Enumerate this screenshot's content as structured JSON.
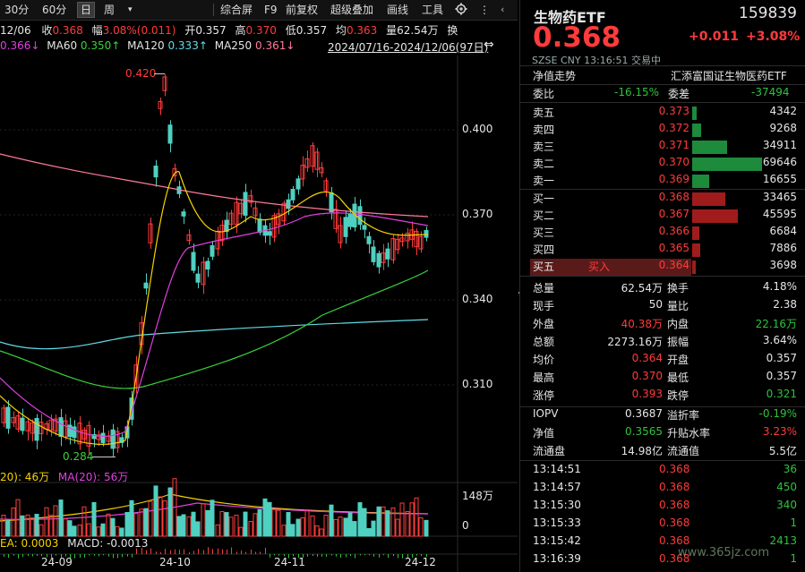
{
  "toolbar": {
    "periods": [
      "30分",
      "60分",
      "日",
      "周"
    ],
    "active_period": "日",
    "more_icon": "dropdown-triangle",
    "menus": [
      "综合屏",
      "F9",
      "前复权",
      "超级叠加",
      "画线",
      "工具"
    ],
    "settings_icon": "gear-icon",
    "more_menu": "⋮"
  },
  "info_bar": {
    "date": "12/06",
    "close_label": "收",
    "close": "0.368",
    "range_label": "幅",
    "range": "3.08%(0.011)",
    "open_label": "开",
    "open": "0.357",
    "high_label": "高",
    "high": "0.370",
    "low_label": "低",
    "low": "0.357",
    "avg_label": "均",
    "avg": "0.363",
    "vol_label": "量",
    "vol": "62.54万",
    "switch_label": "换"
  },
  "ma_bar": {
    "ma_prev": "0.366↓",
    "ma60": "MA60",
    "ma60_val": "0.350↑",
    "ma120": "MA120",
    "ma120_val": "0.333↑",
    "ma250": "MA250",
    "ma250_val": "0.361↓",
    "date_range": "2024/07/16-2024/12/06(97日)",
    "switch_icon": "⇔"
  },
  "price_axis": [
    "0.400",
    "0.370",
    "0.340",
    "0.310"
  ],
  "annotations": {
    "high_mark": "0.420",
    "low_mark": "0.284"
  },
  "volume": {
    "label_a": "20): 46万",
    "label_b": "MA(20): 56万",
    "axis_top": "148万",
    "axis_zero": "0"
  },
  "macd": {
    "dea": "EA: 0.0003",
    "macd": "MACD: -0.0013"
  },
  "date_axis": [
    "24-09",
    "24-10",
    "24-11",
    "24-12"
  ],
  "quote": {
    "name": "生物药ETF",
    "code": "159839",
    "price": "0.368",
    "change": "+0.011",
    "change_pct": "+3.08%",
    "exchange": "SZSE",
    "currency": "CNY",
    "time": "13:16:51",
    "status": "交易中",
    "nav_trend": "净值走势",
    "fund_name": "汇添富国证生物医药ETF",
    "webi_label": "委比",
    "webi": "-16.15%",
    "weicha_label": "委差",
    "weicha": "-37494"
  },
  "order_book": {
    "asks": [
      {
        "label": "卖五",
        "price": "0.373",
        "vol": "4342",
        "ratio": 0.06
      },
      {
        "label": "卖四",
        "price": "0.372",
        "vol": "9268",
        "ratio": 0.13
      },
      {
        "label": "卖三",
        "price": "0.371",
        "vol": "34911",
        "ratio": 0.5
      },
      {
        "label": "卖二",
        "price": "0.370",
        "vol": "69646",
        "ratio": 1.0
      },
      {
        "label": "卖一",
        "price": "0.369",
        "vol": "16655",
        "ratio": 0.24
      }
    ],
    "bids": [
      {
        "label": "买一",
        "price": "0.368",
        "vol": "33465",
        "ratio": 0.48
      },
      {
        "label": "买二",
        "price": "0.367",
        "vol": "45595",
        "ratio": 0.65
      },
      {
        "label": "买三",
        "price": "0.366",
        "vol": "6684",
        "ratio": 0.1
      },
      {
        "label": "买四",
        "price": "0.365",
        "vol": "7886",
        "ratio": 0.11
      },
      {
        "label": "买五",
        "price": "0.364",
        "vol": "3698",
        "ratio": 0.05
      }
    ],
    "buy_button": "买入"
  },
  "stats": [
    {
      "l1": "总量",
      "v1": "62.54万",
      "c1": "white",
      "l2": "换手",
      "v2": "4.18%",
      "c2": "white"
    },
    {
      "l1": "现手",
      "v1": "50",
      "c1": "white",
      "l2": "量比",
      "v2": "2.38",
      "c2": "white"
    },
    {
      "l1": "外盘",
      "v1": "40.38万",
      "c1": "red",
      "l2": "内盘",
      "v2": "22.16万",
      "c2": "green"
    },
    {
      "l1": "总额",
      "v1": "2273.16万",
      "c1": "white",
      "l2": "振幅",
      "v2": "3.64%",
      "c2": "white"
    },
    {
      "l1": "均价",
      "v1": "0.364",
      "c1": "red",
      "l2": "开盘",
      "v2": "0.357",
      "c2": "white"
    },
    {
      "l1": "最高",
      "v1": "0.370",
      "c1": "red",
      "l2": "最低",
      "v2": "0.357",
      "c2": "white"
    },
    {
      "l1": "涨停",
      "v1": "0.393",
      "c1": "red",
      "l2": "跌停",
      "v2": "0.321",
      "c2": "green"
    }
  ],
  "fund_stats": [
    {
      "l1": "IOPV",
      "v1": "0.3687",
      "c1": "white",
      "l2": "溢折率",
      "v2": "-0.19%",
      "c2": "green"
    },
    {
      "l1": "净值",
      "v1": "0.3565",
      "c1": "green",
      "l2": "升贴水率",
      "v2": "3.23%",
      "c2": "red"
    },
    {
      "l1": "流通盘",
      "v1": "14.98亿",
      "c1": "white",
      "l2": "流通值",
      "v2": "5.5亿",
      "c2": "white"
    }
  ],
  "ticks": [
    {
      "time": "13:14:51",
      "price": "0.368",
      "vol": "36",
      "c": "green"
    },
    {
      "time": "13:14:57",
      "price": "0.368",
      "vol": "450",
      "c": "green"
    },
    {
      "time": "13:15:30",
      "price": "0.368",
      "vol": "340",
      "c": "green"
    },
    {
      "time": "13:15:33",
      "price": "0.368",
      "vol": "1",
      "c": "green"
    },
    {
      "time": "13:15:42",
      "price": "0.368",
      "vol": "2413",
      "c": "green"
    },
    {
      "time": "13:16:39",
      "price": "0.368",
      "vol": "1",
      "c": "green"
    }
  ],
  "collapse_icon": "chevron-left-icon",
  "watermark": "www.365jz.com",
  "colors": {
    "up": "#ff3b3b",
    "down": "#2fc23a",
    "bg": "#000000",
    "ma5": "#f5d300",
    "ma10": "#e040e0",
    "ma60": "#3ad13a",
    "ma120": "#62dbe6",
    "ma250": "#ff7a9a"
  }
}
